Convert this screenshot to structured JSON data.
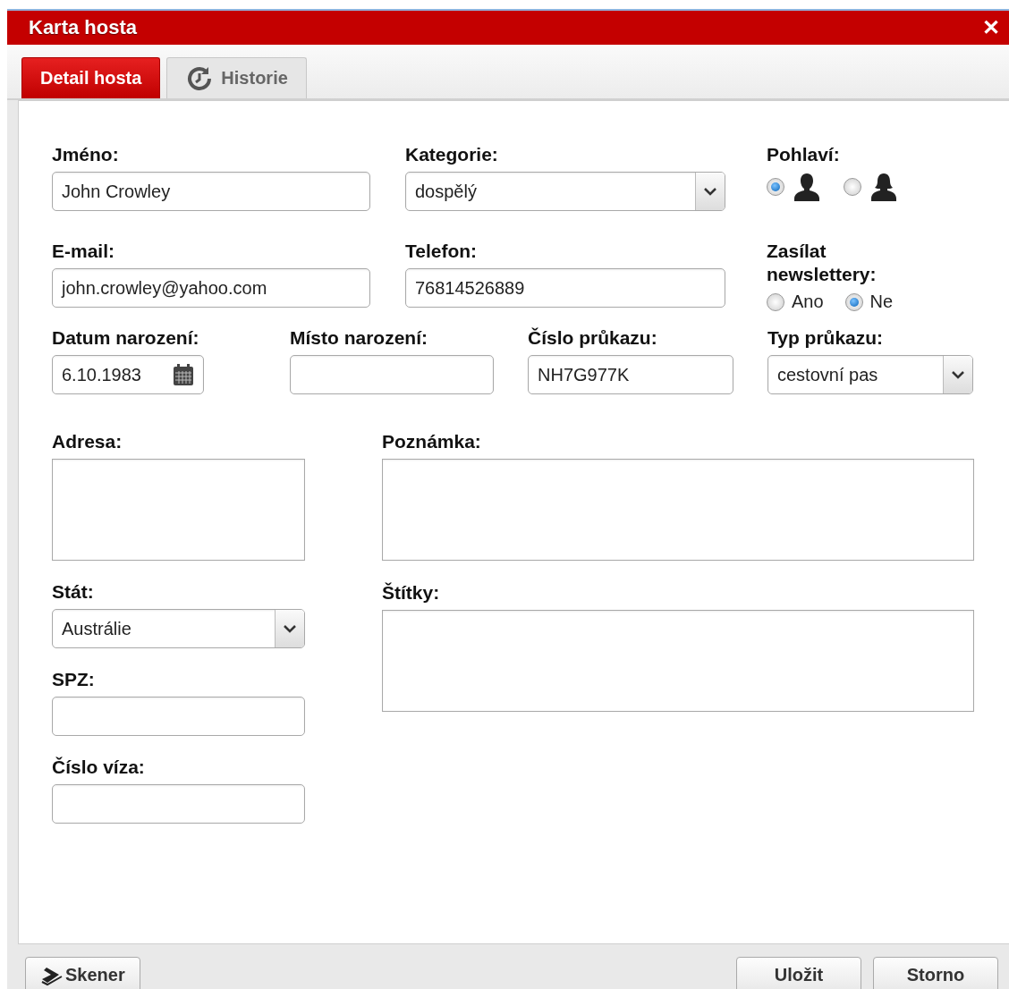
{
  "window": {
    "title": "Karta hosta",
    "close": "✕"
  },
  "tabs": [
    {
      "label": "Detail hosta",
      "selected": true,
      "kind": "plain"
    },
    {
      "label": "Historie",
      "selected": false,
      "kind": "history"
    }
  ],
  "row_1": [
    {
      "kind": "text",
      "label": "Jméno:",
      "value": "John Crowley"
    },
    {
      "kind": "select",
      "label": "Kategorie:",
      "value": "dospělý"
    },
    {
      "kind": "radio",
      "label": "Pohlaví:",
      "options": [
        {
          "kind": "male",
          "selected": true
        },
        {
          "kind": "female",
          "selected": false
        }
      ]
    }
  ],
  "row_2": [
    {
      "kind": "text",
      "label": "E-mail:",
      "value": "john.crowley@yahoo.com"
    },
    {
      "kind": "text",
      "label": "Telefon:",
      "value": "76814526889"
    },
    {
      "kind": "radio",
      "label": "Zasílat newslettery:",
      "options": [
        {
          "kind": "text",
          "label": "Ano",
          "selected": false
        },
        {
          "kind": "text",
          "label": "Ne",
          "selected": true
        }
      ]
    }
  ],
  "row_3": [
    {
      "kind": "date",
      "label": "Datum narození:",
      "value": "6.10.1983"
    },
    {
      "kind": "text",
      "label": "Místo narození:"
    },
    {
      "kind": "text",
      "label": "Číslo průkazu:",
      "value": "NH7G977K"
    },
    {
      "kind": "select",
      "label": "Typ průkazu:",
      "value": "cestovní pas"
    }
  ],
  "left_column": [
    {
      "kind": "textarea",
      "label": "Adresa:"
    },
    {
      "kind": "select",
      "label": "Stát:",
      "value": "Austrálie"
    },
    {
      "kind": "text",
      "label": "SPZ:"
    },
    {
      "kind": "text",
      "label": "Číslo víza:"
    }
  ],
  "right_column": [
    {
      "kind": "textarea",
      "label": "Poznámka:"
    },
    {
      "kind": "textarea",
      "label": "Štítky:"
    }
  ],
  "buttons": [
    {
      "label": "Skener",
      "kind": "scanner"
    },
    {
      "label": "Uložit",
      "kind": "plain"
    },
    {
      "label": "Storno",
      "kind": "plain"
    }
  ]
}
